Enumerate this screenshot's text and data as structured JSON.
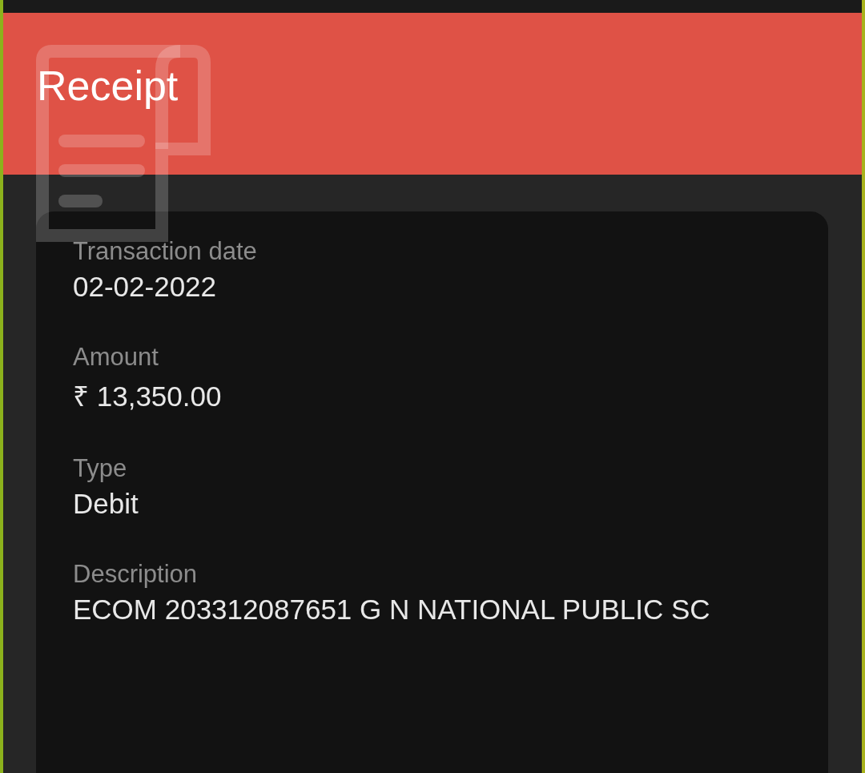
{
  "header": {
    "title": "Receipt"
  },
  "fields": [
    {
      "label": "Transaction date",
      "value": "02-02-2022"
    },
    {
      "label": "Amount",
      "value": "₹ 13,350.00"
    },
    {
      "label": "Type",
      "value": "Debit"
    },
    {
      "label": "Description",
      "value": "ECOM 203312087651 G N NATIONAL PUBLIC SC"
    }
  ]
}
